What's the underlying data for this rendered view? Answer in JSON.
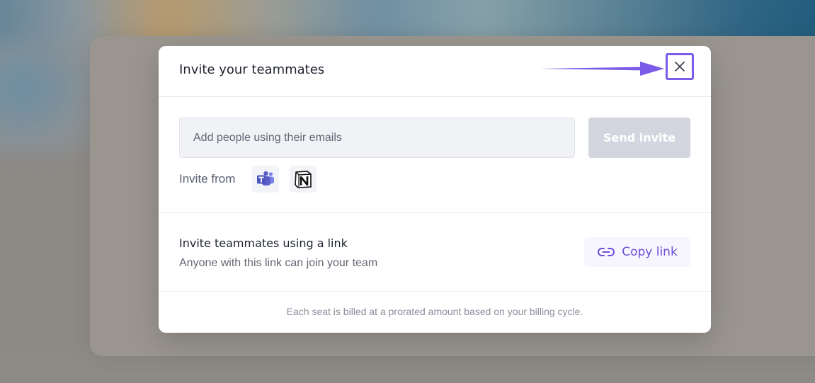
{
  "modal": {
    "title": "Invite your teammates",
    "close_icon": "close-icon",
    "annotation_arrow_color": "#7a5ce8"
  },
  "invite": {
    "email_placeholder": "Add people using their emails",
    "email_value": "",
    "send_label": "Send invite",
    "invite_from_label": "Invite from",
    "apps": [
      {
        "name": "Microsoft Teams",
        "icon": "teams-icon"
      },
      {
        "name": "Notion",
        "icon": "notion-icon"
      }
    ]
  },
  "link_invite": {
    "title": "Invite teammates using a link",
    "description": "Anyone with this link can join your team",
    "copy_label": "Copy link",
    "copy_icon": "link-icon"
  },
  "footer": {
    "note": "Each seat is billed at a prorated amount based on your billing cycle."
  },
  "colors": {
    "accent": "#6b4fd8",
    "send_button_disabled": "#d3d6de",
    "teams": "#5b5fc7"
  }
}
